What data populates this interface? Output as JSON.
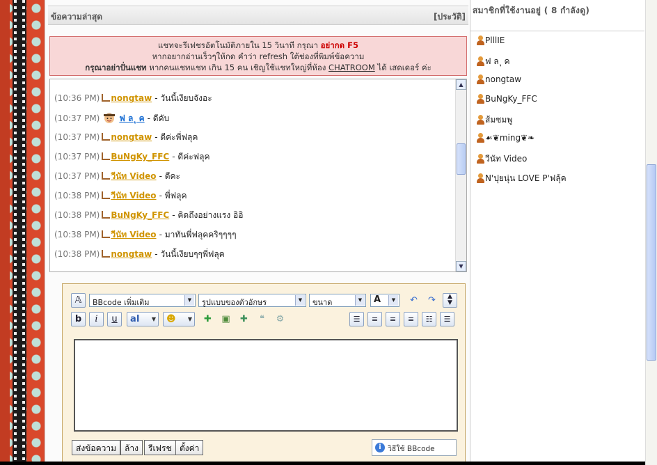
{
  "chat": {
    "title": "ข้อความล่าสุด",
    "history_link": "[ประวัติ]",
    "notice": {
      "line1_text": "แชทจะรีเฟชรอัตโนมัติภายใน 15 วินาที กรุณา",
      "line1_emph": "อย่ากด F5",
      "line2": "หากอยากอ่านเร็วๆให้กด คำว่า refresh ใต้ช่องที่พิมพ์ข้อความ",
      "line3_bold": "กรุณาอย่าปั่นแชท",
      "line3_text": "หากคนแชทแชท เกิน 15 คน เชิญใช้แชทใหญ่ที่ห้อง",
      "line3_link": "CHATROOM",
      "line3_tail": "ได้ เสดเดอร์ ค่ะ"
    },
    "messages": [
      {
        "time": "(10:36 PM)",
        "nick": "nongtaw",
        "text": "- วันนี้เงียบจังอะ",
        "icon": "note-icon"
      },
      {
        "time": "(10:37 PM)",
        "nick": "ฟ ล ุ ค",
        "text": "- ดีคับ",
        "icon": "face-icon",
        "blue": true
      },
      {
        "time": "(10:37 PM)",
        "nick": "nongtaw",
        "text": "- ดีค่ะพี่ฟลุค",
        "icon": "note-icon"
      },
      {
        "time": "(10:37 PM)",
        "nick": "BuNgKy_FFC",
        "text": "- ดีค่ะฟลุค",
        "icon": "note-icon"
      },
      {
        "time": "(10:37 PM)",
        "nick": "วีนัท Video",
        "text": "- ดีคะ",
        "icon": "note-icon"
      },
      {
        "time": "(10:38 PM)",
        "nick": "วีนัท Video",
        "text": "- พี่ฟลุค",
        "icon": "note-icon"
      },
      {
        "time": "(10:38 PM)",
        "nick": "BuNgKy_FFC",
        "text": "- คิดถึงอย่างแรง อิอิ",
        "icon": "note-icon"
      },
      {
        "time": "(10:38 PM)",
        "nick": "วีนัท Video",
        "text": "- มาทันพี่ฟลุคคริๆๆๆๆ",
        "icon": "note-icon"
      },
      {
        "time": "(10:38 PM)",
        "nick": "nongtaw",
        "text": "- วันนี้เงียบๆๆพี่ฟลุค",
        "icon": "note-icon"
      }
    ]
  },
  "editor": {
    "bbcode_select": "BBcode เพิ่มเติม",
    "font_select": "รูปแบบของตัวอักษร",
    "size_select": "ขนาด",
    "buttons": {
      "send": "ส่งข้อความ",
      "clear": "ล้าง",
      "refresh": "รีเฟรช",
      "settings": "ตั้งค่า"
    },
    "bbcode_help": "วิธีใช้ BBcode"
  },
  "members": {
    "title": "สมาชิกที่ใช้งานอยู่ ( 8 กำลังดู)",
    "list": [
      "PlllIE",
      "ฟ ล ุ ค",
      "nongtaw",
      "BuNgKy_FFC",
      "ส้มซมพู",
      "☙❦ming❦❧",
      "วีนัท Video",
      "N'ปุยนุ่น LOVE P'ฟลุ้ค"
    ]
  },
  "colors": {
    "notice_bg": "#f8d7d7",
    "nick": "#d09400",
    "nick_alt": "#1b6fd4",
    "editor_bg": "#fbf2de"
  }
}
